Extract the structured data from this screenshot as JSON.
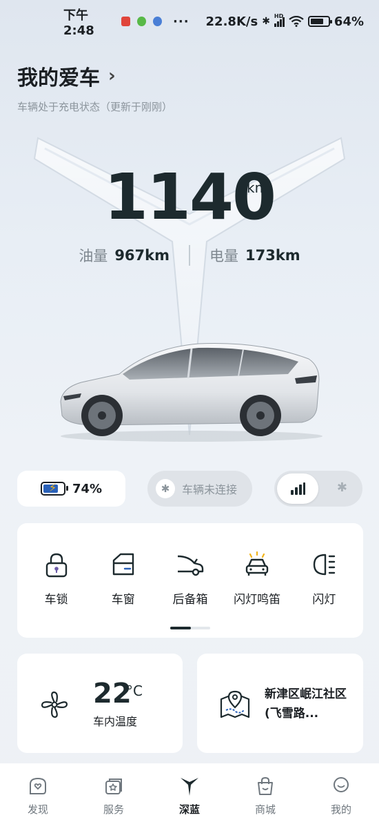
{
  "status_bar": {
    "time": "下午2:48",
    "more": "···",
    "network_speed": "22.8K/s",
    "bluetooth": "✱",
    "signal_badge": "HD",
    "battery_percent": "64%",
    "battery_level": 0.64
  },
  "header": {
    "title": "我的爱车",
    "subtitle": "车辆处于充电状态（更新于刚刚）"
  },
  "range": {
    "total": "1140",
    "unit": "km",
    "fuel_label": "油量",
    "fuel_value": "967km",
    "electric_label": "电量",
    "electric_value": "173km"
  },
  "status_row": {
    "battery_percent": "74%",
    "battery_level": 0.74,
    "connection": "车辆未连接",
    "toggle_selected": "signal"
  },
  "controls": [
    {
      "label": "车锁",
      "icon": "lock-icon"
    },
    {
      "label": "车窗",
      "icon": "window-icon"
    },
    {
      "label": "后备箱",
      "icon": "trunk-icon"
    },
    {
      "label": "闪灯鸣笛",
      "icon": "flash-horn-icon"
    },
    {
      "label": "闪灯",
      "icon": "headlight-icon"
    }
  ],
  "climate": {
    "temperature": "22",
    "unit": "°C",
    "label": "车内温度"
  },
  "location": {
    "address": "新津区岷江社区(飞雪路..."
  },
  "nav": [
    {
      "label": "发现",
      "icon": "discover-icon"
    },
    {
      "label": "服务",
      "icon": "service-icon"
    },
    {
      "label": "深蓝",
      "icon": "deepal-logo-icon"
    },
    {
      "label": "商城",
      "icon": "shop-icon"
    },
    {
      "label": "我的",
      "icon": "profile-icon"
    }
  ],
  "colors": {
    "accent": "#2a61b8",
    "charging": "#f2b41c",
    "text_primary": "#1d2a2e"
  }
}
